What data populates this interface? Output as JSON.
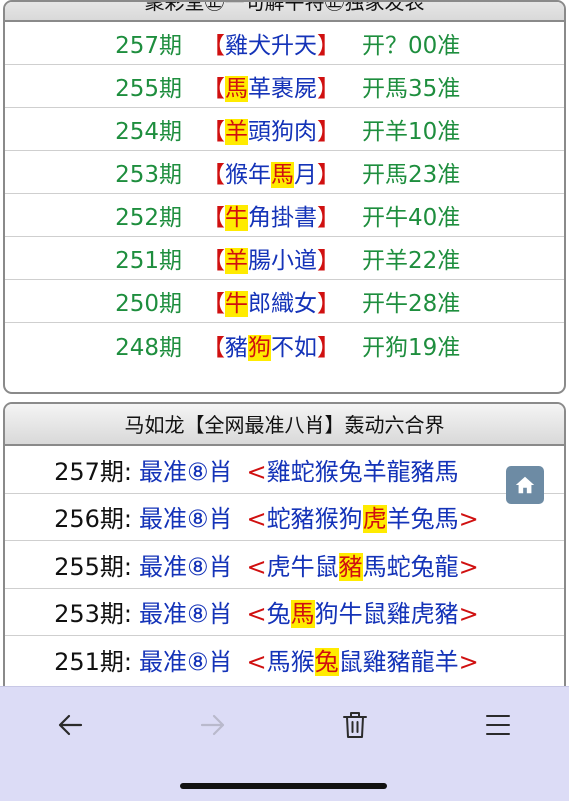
{
  "panel1": {
    "title": "聚彩堂㊣一句解平特㊣独家发表",
    "rows": [
      {
        "period": "257期",
        "open": "【",
        "parts": [
          {
            "t": "雞犬升天",
            "hl": false
          }
        ],
        "close": "】",
        "result": "开？00准"
      },
      {
        "period": "255期",
        "open": "【",
        "parts": [
          {
            "t": "馬",
            "hl": true
          },
          {
            "t": "革裹屍",
            "hl": false
          }
        ],
        "close": "】",
        "result": "开馬35准"
      },
      {
        "period": "254期",
        "open": "【",
        "parts": [
          {
            "t": "羊",
            "hl": true
          },
          {
            "t": "頭狗肉",
            "hl": false
          }
        ],
        "close": "】",
        "result": "开羊10准"
      },
      {
        "period": "253期",
        "open": "【",
        "parts": [
          {
            "t": "猴年",
            "hl": false
          },
          {
            "t": "馬",
            "hl": true
          },
          {
            "t": "月",
            "hl": false
          }
        ],
        "close": "】",
        "result": "开馬23准"
      },
      {
        "period": "252期",
        "open": "【",
        "parts": [
          {
            "t": "牛",
            "hl": true
          },
          {
            "t": "角掛書",
            "hl": false
          }
        ],
        "close": "】",
        "result": "开牛40准"
      },
      {
        "period": "251期",
        "open": "【",
        "parts": [
          {
            "t": "羊",
            "hl": true
          },
          {
            "t": "腸小道",
            "hl": false
          }
        ],
        "close": "】",
        "result": "开羊22准"
      },
      {
        "period": "250期",
        "open": "【",
        "parts": [
          {
            "t": "牛",
            "hl": true
          },
          {
            "t": "郎織女",
            "hl": false
          }
        ],
        "close": "】",
        "result": "开牛28准"
      },
      {
        "period": "248期",
        "open": "【",
        "parts": [
          {
            "t": "豬",
            "hl": false
          },
          {
            "t": "狗",
            "hl": true
          },
          {
            "t": "不如",
            "hl": false
          }
        ],
        "close": "】",
        "result": "开狗19准"
      }
    ]
  },
  "panel2": {
    "title": "马如龙【全网最准八肖】轰动六合界",
    "rows": [
      {
        "period": "257期:",
        "label": "最准⑧肖",
        "open": "<",
        "parts": [
          {
            "t": "雞蛇猴兔羊龍豬馬",
            "hl": false
          }
        ],
        "close": ""
      },
      {
        "period": "256期:",
        "label": "最准⑧肖",
        "open": "<",
        "parts": [
          {
            "t": "蛇豬猴狗",
            "hl": false
          },
          {
            "t": "虎",
            "hl": true
          },
          {
            "t": "羊兔馬",
            "hl": false
          }
        ],
        "close": ">"
      },
      {
        "period": "255期:",
        "label": "最准⑧肖",
        "open": "<",
        "parts": [
          {
            "t": "虎牛鼠",
            "hl": false
          },
          {
            "t": "豬",
            "hl": true
          },
          {
            "t": "馬蛇兔龍",
            "hl": false
          }
        ],
        "close": ">"
      },
      {
        "period": "253期:",
        "label": "最准⑧肖",
        "open": "<",
        "parts": [
          {
            "t": "兔",
            "hl": false
          },
          {
            "t": "馬",
            "hl": true
          },
          {
            "t": "狗牛鼠雞虎豬",
            "hl": false
          }
        ],
        "close": ">"
      },
      {
        "period": "251期:",
        "label": "最准⑧肖",
        "open": "<",
        "parts": [
          {
            "t": "馬猴",
            "hl": false
          },
          {
            "t": "兔",
            "hl": true
          },
          {
            "t": "鼠雞豬龍羊",
            "hl": false
          }
        ],
        "close": ">"
      }
    ]
  },
  "home_button": {
    "icon": "home-icon"
  },
  "toolbar": {
    "buttons": [
      {
        "icon": "back-arrow-icon",
        "enabled": true
      },
      {
        "icon": "forward-arrow-icon",
        "enabled": false
      },
      {
        "icon": "trash-icon",
        "enabled": true
      },
      {
        "icon": "menu-icon",
        "enabled": true
      }
    ]
  },
  "colors": {
    "period_green": "#1e8e3e",
    "riddle_blue": "#1433b8",
    "bracket_red": "#d01010",
    "highlight_yellow": "#ffeb00",
    "toolbar_bg": "#dcdcf6"
  }
}
